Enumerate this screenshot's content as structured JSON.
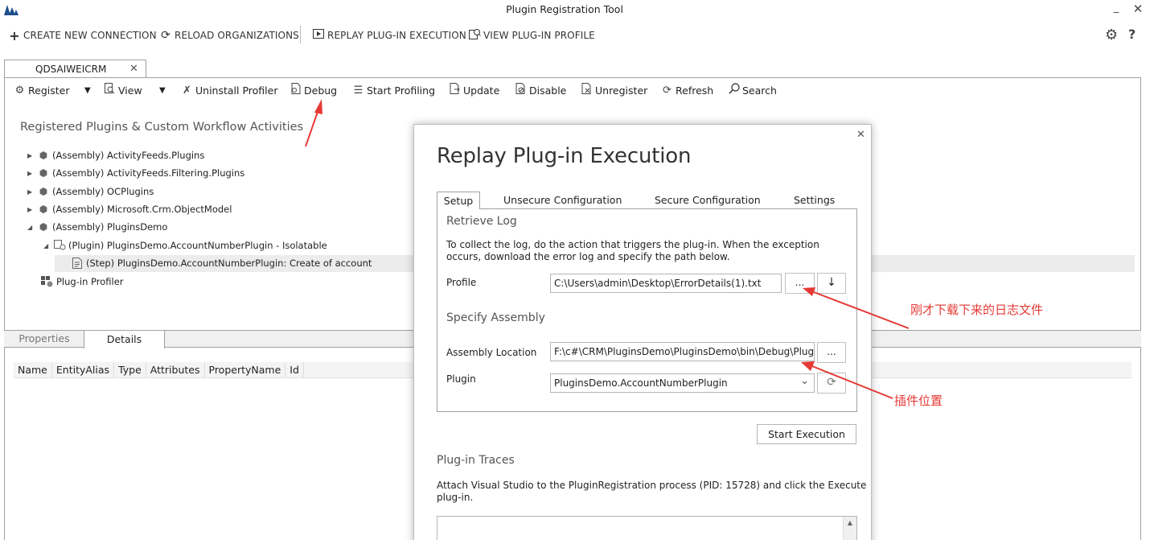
{
  "window": {
    "title": "Plugin Registration Tool",
    "minimize": "_",
    "close": "✕"
  },
  "main_toolbar": {
    "create_connection": "CREATE NEW CONNECTION",
    "reload_orgs": "RELOAD ORGANIZATIONS",
    "replay": "REPLAY PLUG-IN EXECUTION",
    "view_profile": "VIEW PLUG-IN PROFILE",
    "settings_glyph": "⚙",
    "help": "?"
  },
  "org_tab": {
    "label": "QDSAIWEICRM",
    "close": "✕"
  },
  "toolbar": {
    "register": "Register",
    "view": "View",
    "uninstall_profiler": "Uninstall Profiler",
    "debug": "Debug",
    "start_profiling": "Start Profiling",
    "update": "Update",
    "disable": "Disable",
    "unregister": "Unregister",
    "refresh": "Refresh",
    "search": "Search"
  },
  "tree": {
    "heading": "Registered Plugins & Custom Workflow Activities",
    "items": [
      {
        "label": "(Assembly) ActivityFeeds.Plugins",
        "arrow": "▶"
      },
      {
        "label": "(Assembly) ActivityFeeds.Filtering.Plugins",
        "arrow": "▶"
      },
      {
        "label": "(Assembly) OCPlugins",
        "arrow": "▶"
      },
      {
        "label": "(Assembly) Microsoft.Crm.ObjectModel",
        "arrow": "▶"
      },
      {
        "label": "(Assembly) PluginsDemo",
        "arrow": "◢"
      },
      {
        "label": "(Plugin) PluginsDemo.AccountNumberPlugin - Isolatable",
        "arrow": "◢"
      },
      {
        "label": "(Step) PluginsDemo.AccountNumberPlugin: Create of account"
      },
      {
        "label": "Plug-in Profiler"
      }
    ]
  },
  "lower_tabs": {
    "properties": "Properties",
    "details": "Details"
  },
  "details_columns": [
    "Name",
    "EntityAlias",
    "Type",
    "Attributes",
    "PropertyName",
    "Id"
  ],
  "dialog": {
    "title": "Replay Plug-in Execution",
    "close": "✕",
    "tabs": [
      "Setup",
      "Unsecure Configuration",
      "Secure Configuration",
      "Settings"
    ],
    "retrieve_log_title": "Retrieve Log",
    "retrieve_log_text_1": "To collect the log, do the action that triggers the plug-in. When the exception",
    "retrieve_log_text_2": "occurs, download the error log and specify the path below.",
    "profile_label": "Profile",
    "profile_value": "C:\\Users\\admin\\Desktop\\ErrorDetails(1).txt",
    "browse_label": "...",
    "download_glyph": "↓",
    "specify_assembly_title": "Specify Assembly",
    "assembly_location_label": "Assembly Location",
    "assembly_location_value": "F:\\c#\\CRM\\PluginsDemo\\PluginsDemo\\bin\\Debug\\Plug",
    "plugin_label": "Plugin",
    "plugin_value": "PluginsDemo.AccountNumberPlugin",
    "dropdown_glyph": "⌄",
    "refresh_glyph": "⟳",
    "start_execution": "Start Execution",
    "traces_title": "Plug-in Traces",
    "traces_text_1": "Attach Visual Studio to the PluginRegistration process (PID: 15728) and click the Execute",
    "traces_text_2": "plug-in.",
    "scroll_up_glyph": "▲"
  },
  "annotations": {
    "log_file": "刚才下载下来的日志文件",
    "plugin_location": "插件位置",
    "color": "#e53935"
  }
}
